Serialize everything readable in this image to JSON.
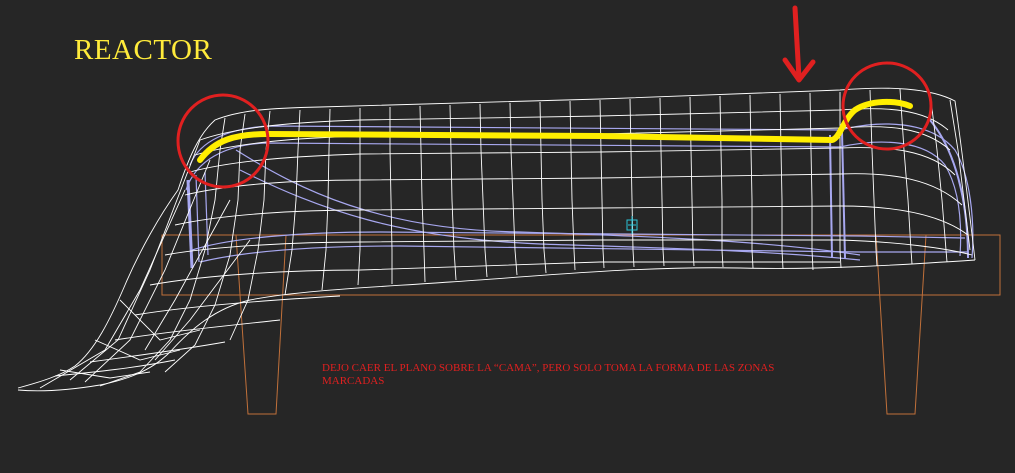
{
  "viewport": {
    "title": "REACTOR",
    "caption": "DEJO CAER EL PLANO SOBRE LA “CAMA”, PERO SOLO TOMA LA FORMA DE LAS ZONAS MARCADAS",
    "icons": {
      "pivot": "pivot-gizmo-icon",
      "arrow": "arrow-down-icon"
    },
    "colors": {
      "background": "#262626",
      "wireframe": "#ffffff",
      "cushion": "#a8a8f0",
      "bed_frame": "#c0703a",
      "highlight": "#ffee00",
      "annotation": "#e02020",
      "pivot": "#29c4d8"
    }
  }
}
